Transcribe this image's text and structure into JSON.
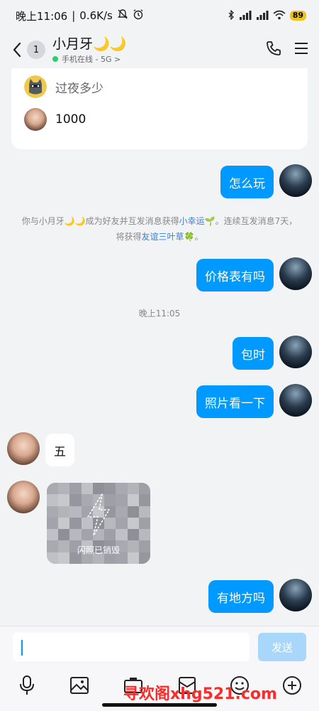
{
  "status_bar": {
    "time": "晚上11:06",
    "network_speed": "0.6K/s",
    "battery": "89"
  },
  "header": {
    "unread_count": "1",
    "contact_name": "小月牙🌙🌙",
    "status": "手机在线 - 5G >"
  },
  "card": {
    "clipped_text": "...",
    "rows": [
      {
        "text": "过夜多少"
      },
      {
        "text": "1000"
      }
    ]
  },
  "messages": {
    "m1": "怎么玩",
    "sys_prefix": "你与小月牙🌙🌙成为好友并互发消息获得",
    "sys_link1": "小幸运🌱",
    "sys_mid": "。连续互发消息7天，将获得",
    "sys_link2": "友谊三叶草🍀",
    "sys_suffix": "。",
    "m2": "价格表有吗",
    "timestamp": "晚上11:05",
    "m3": "包时",
    "m4": "照片看一下",
    "m5": "五",
    "flash_caption": "闪照已销毁",
    "m6": "有地方吗"
  },
  "input": {
    "value": "",
    "send_label": "发送"
  },
  "toolbar": {
    "icons": [
      "mic-icon",
      "image-icon",
      "camera-icon",
      "red-packet-icon",
      "emoji-icon",
      "plus-icon"
    ]
  },
  "watermark": "寻欢阁xhg521.com",
  "colors": {
    "accent": "#0099ff",
    "send_disabled": "#a8d7fb",
    "watermark": "#ff2a2a"
  }
}
